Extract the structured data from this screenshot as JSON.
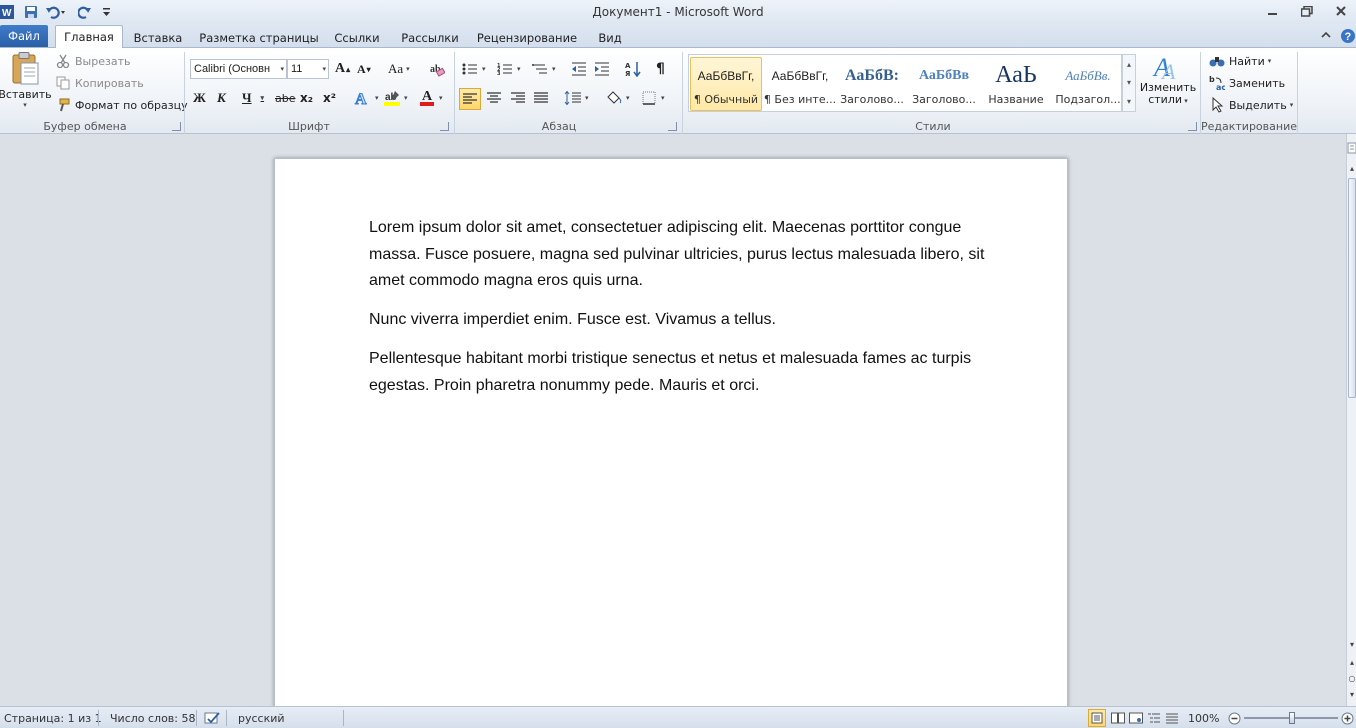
{
  "window": {
    "title": "Документ1  -  Microsoft Word"
  },
  "tabs": [
    {
      "label": "Файл",
      "active": false
    },
    {
      "label": "Главная",
      "active": true
    },
    {
      "label": "Вставка",
      "active": false
    },
    {
      "label": "Разметка страницы",
      "active": false
    },
    {
      "label": "Ссылки",
      "active": false
    },
    {
      "label": "Рассылки",
      "active": false
    },
    {
      "label": "Рецензирование",
      "active": false
    },
    {
      "label": "Вид",
      "active": false
    }
  ],
  "clipboard": {
    "paste_label": "Вставить",
    "cut_label": "Вырезать",
    "copy_label": "Копировать",
    "format_painter_label": "Формат по образцу",
    "group_label": "Буфер обмена"
  },
  "font": {
    "font_name": "Calibri (Основн",
    "font_size": "11",
    "bold": "Ж",
    "italic": "К",
    "underline": "Ч",
    "strike": "abe",
    "subscript": "x₂",
    "superscript": "x²",
    "grow": "A",
    "shrink": "A",
    "change_case": "Aa",
    "font_color_glyph": "A",
    "group_label": "Шрифт"
  },
  "paragraph": {
    "group_label": "Абзац",
    "pilcrow": "¶"
  },
  "styles": {
    "group_label": "Стили",
    "items": [
      {
        "preview": "АаБбВвГг,",
        "name": "¶ Обычный",
        "selected": true
      },
      {
        "preview": "АаБбВвГг,",
        "name": "¶ Без инте...",
        "selected": false
      },
      {
        "preview": "АаБбВ:",
        "name": "Заголово...",
        "selected": false
      },
      {
        "preview": "АаБбВв",
        "name": "Заголово...",
        "selected": false
      },
      {
        "preview": "АаЬ",
        "name": "Название",
        "selected": false
      },
      {
        "preview": "АаБбВв.",
        "name": "Подзагол...",
        "selected": false
      }
    ],
    "change_styles_line1": "Изменить",
    "change_styles_line2": "стили"
  },
  "editing": {
    "find_label": "Найти",
    "replace_label": "Заменить",
    "select_label": "Выделить",
    "group_label": "Редактирование"
  },
  "document": {
    "paragraphs": [
      "Lorem ipsum dolor sit amet, consectetuer adipiscing elit. Maecenas porttitor congue massa. Fusce posuere, magna sed pulvinar ultricies, purus lectus malesuada libero, sit amet commodo magna eros quis urna.",
      "Nunc viverra imperdiet enim. Fusce est. Vivamus a tellus.",
      "Pellentesque habitant morbi tristique senectus et netus et malesuada fames ac turpis egestas. Proin pharetra nonummy pede. Mauris et orci."
    ]
  },
  "status": {
    "page": "Страница: 1 из 1",
    "words": "Число слов: 58",
    "language": "русский",
    "zoom": "100%"
  },
  "colors": {
    "accent": "#2b579a",
    "file_tab": "#2f66b1",
    "highlight": "#ffff00",
    "font_color": "#e01b1b"
  }
}
